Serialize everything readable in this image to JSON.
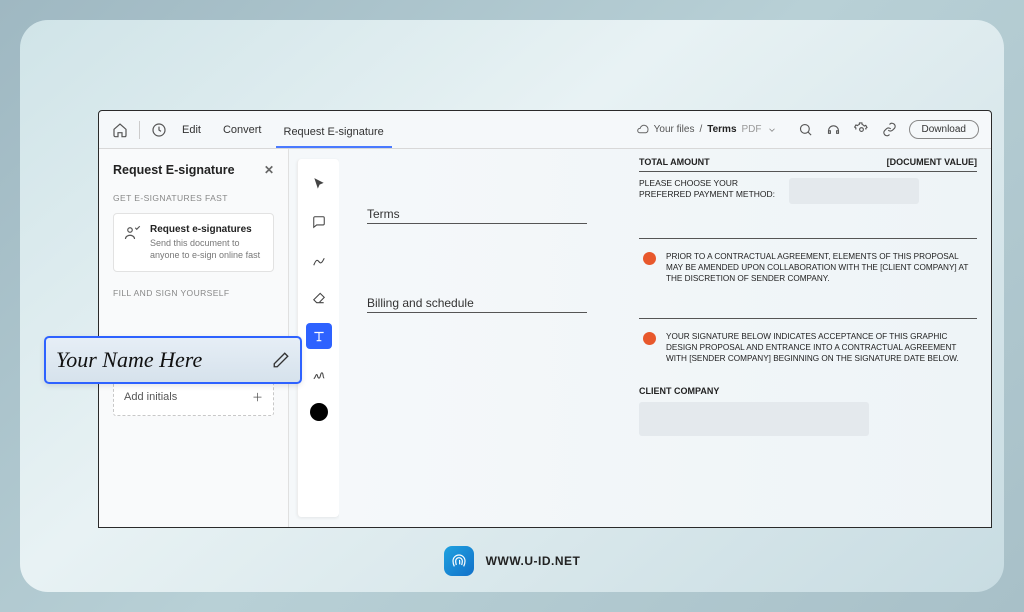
{
  "topbar": {
    "menu": {
      "edit": "Edit",
      "convert": "Convert",
      "request_esig": "Request E-signature"
    },
    "breadcrumb": {
      "root": "Your files",
      "sep": "/",
      "current": "Terms",
      "type": "PDF"
    },
    "download": "Download"
  },
  "sidebar": {
    "title": "Request E-signature",
    "section_fast": "GET E-SIGNATURES FAST",
    "card_title": "Request e-signatures",
    "card_desc": "Send this document to anyone to e-sign online fast",
    "section_self": "FILL AND SIGN YOURSELF",
    "add_initials": "Add initials"
  },
  "signature": {
    "placeholder": "Your Name Here"
  },
  "document": {
    "section_terms": "Terms",
    "section_billing": "Billing and schedule",
    "total_label": "TOTAL AMOUNT",
    "total_value": "[DOCUMENT VALUE]",
    "payment_label": "PLEASE CHOOSE YOUR PREFERRED PAYMENT METHOD:",
    "term1": "PRIOR TO A CONTRACTUAL AGREEMENT, ELEMENTS OF THIS PROPOSAL MAY BE AMENDED UPON COLLABORATION WITH THE [CLIENT COMPANY] AT THE DISCRETION OF SENDER COMPANY.",
    "term2": "YOUR SIGNATURE BELOW INDICATES ACCEPTANCE OF THIS GRAPHIC DESIGN PROPOSAL AND ENTRANCE INTO A CONTRACTUAL AGREEMENT WITH [SENDER COMPANY] BEGINNING ON THE SIGNATURE DATE BELOW.",
    "client_label": "CLIENT COMPANY"
  },
  "footer": {
    "site": "WWW.U-ID.NET"
  }
}
